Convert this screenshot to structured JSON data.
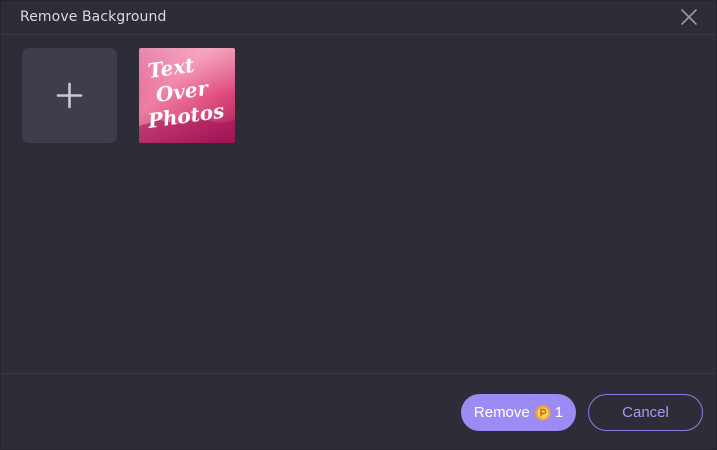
{
  "dialog": {
    "title": "Remove Background"
  },
  "images": {
    "add_icon": "plus-icon",
    "thumbnail_caption": [
      "Text",
      "Over",
      "Photos"
    ]
  },
  "footer": {
    "remove_label": "Remove",
    "credit_cost": "1",
    "cancel_label": "Cancel"
  },
  "colors": {
    "background": "#2d2d38",
    "accent": "#9d8bf4",
    "coin": "#f5a623"
  }
}
